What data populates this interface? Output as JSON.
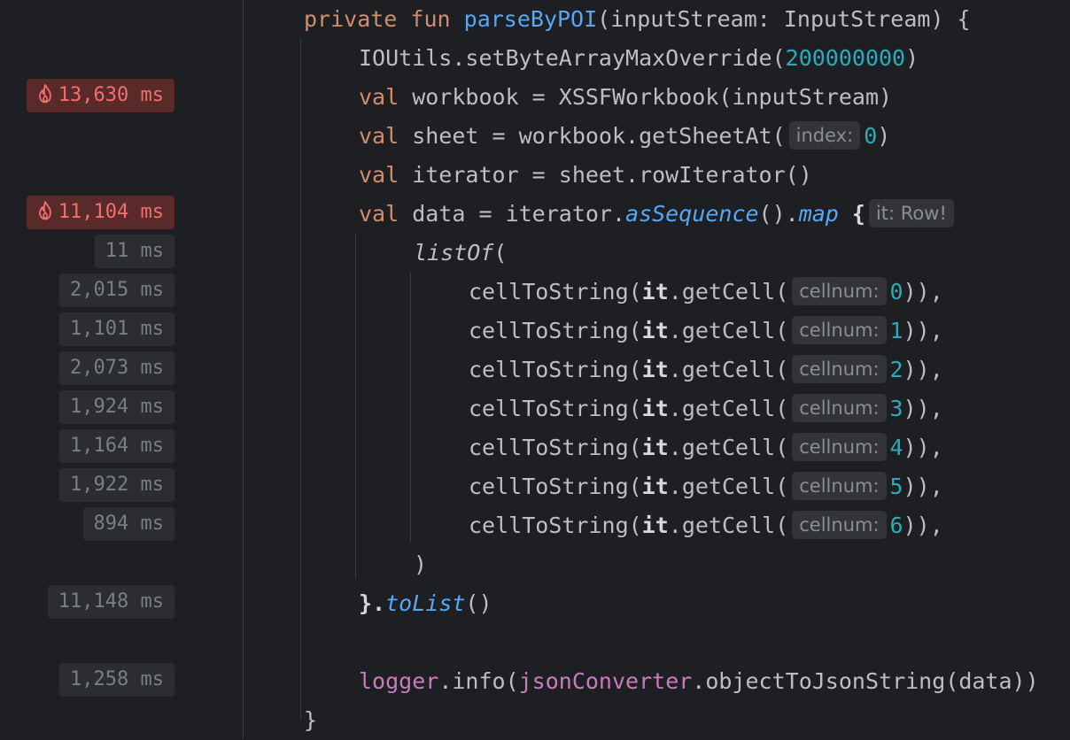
{
  "timings": [
    {
      "label": "13,630 ms",
      "hot": true
    },
    {
      "label": "11,104 ms",
      "hot": true
    },
    {
      "label": "11 ms",
      "hot": false
    },
    {
      "label": "2,015 ms",
      "hot": false
    },
    {
      "label": "1,101 ms",
      "hot": false
    },
    {
      "label": "2,073 ms",
      "hot": false
    },
    {
      "label": "1,924 ms",
      "hot": false
    },
    {
      "label": "1,164 ms",
      "hot": false
    },
    {
      "label": "1,922 ms",
      "hot": false
    },
    {
      "label": "894 ms",
      "hot": false
    },
    {
      "label": "11,148 ms",
      "hot": false
    },
    {
      "label": "1,258 ms",
      "hot": false
    }
  ],
  "code": {
    "l1": {
      "kw_private": "private",
      "kw_fun": "fun",
      "fn_name": "parseByPOI",
      "rest": "(inputStream: InputStream) {"
    },
    "l2": {
      "pre": "IOUtils.setByteArrayMaxOverride(",
      "num": "200000000",
      "post": ")"
    },
    "l3": {
      "kw": "val",
      "rest": " workbook = XSSFWorkbook(inputStream)"
    },
    "l4": {
      "kw": "val",
      "rest": " sheet = workbook.getSheetAt(",
      "hint": "index:",
      "num": "0",
      "post": ")"
    },
    "l5": {
      "kw": "val",
      "rest": " iterator = sheet.rowIterator()"
    },
    "l6": {
      "kw": "val",
      "rest": " data = iterator.",
      "ext1": "asSequence",
      "mid": "().",
      "ext2": "map",
      "brace": " {",
      "hint": "it: Row!"
    },
    "l7": {
      "fn": "listOf",
      "post": "("
    },
    "cells": [
      {
        "pre": "cellToString(",
        "it": "it",
        "mid": ".getCell(",
        "hint": "cellnum:",
        "num": "0",
        "post": ")),"
      },
      {
        "pre": "cellToString(",
        "it": "it",
        "mid": ".getCell(",
        "hint": "cellnum:",
        "num": "1",
        "post": ")),"
      },
      {
        "pre": "cellToString(",
        "it": "it",
        "mid": ".getCell(",
        "hint": "cellnum:",
        "num": "2",
        "post": ")),"
      },
      {
        "pre": "cellToString(",
        "it": "it",
        "mid": ".getCell(",
        "hint": "cellnum:",
        "num": "3",
        "post": ")),"
      },
      {
        "pre": "cellToString(",
        "it": "it",
        "mid": ".getCell(",
        "hint": "cellnum:",
        "num": "4",
        "post": ")),"
      },
      {
        "pre": "cellToString(",
        "it": "it",
        "mid": ".getCell(",
        "hint": "cellnum:",
        "num": "5",
        "post": ")),"
      },
      {
        "pre": "cellToString(",
        "it": "it",
        "mid": ".getCell(",
        "hint": "cellnum:",
        "num": "6",
        "post": ")),"
      }
    ],
    "l15": {
      "text": ")"
    },
    "l16": {
      "pre": "}.",
      "ext": "toList",
      "post": "()"
    },
    "l18": {
      "prop1": "logger",
      "mid": ".info(",
      "prop2": "jsonConverter",
      "post": ".objectToJsonString(data))"
    },
    "l19": {
      "text": "}"
    }
  }
}
